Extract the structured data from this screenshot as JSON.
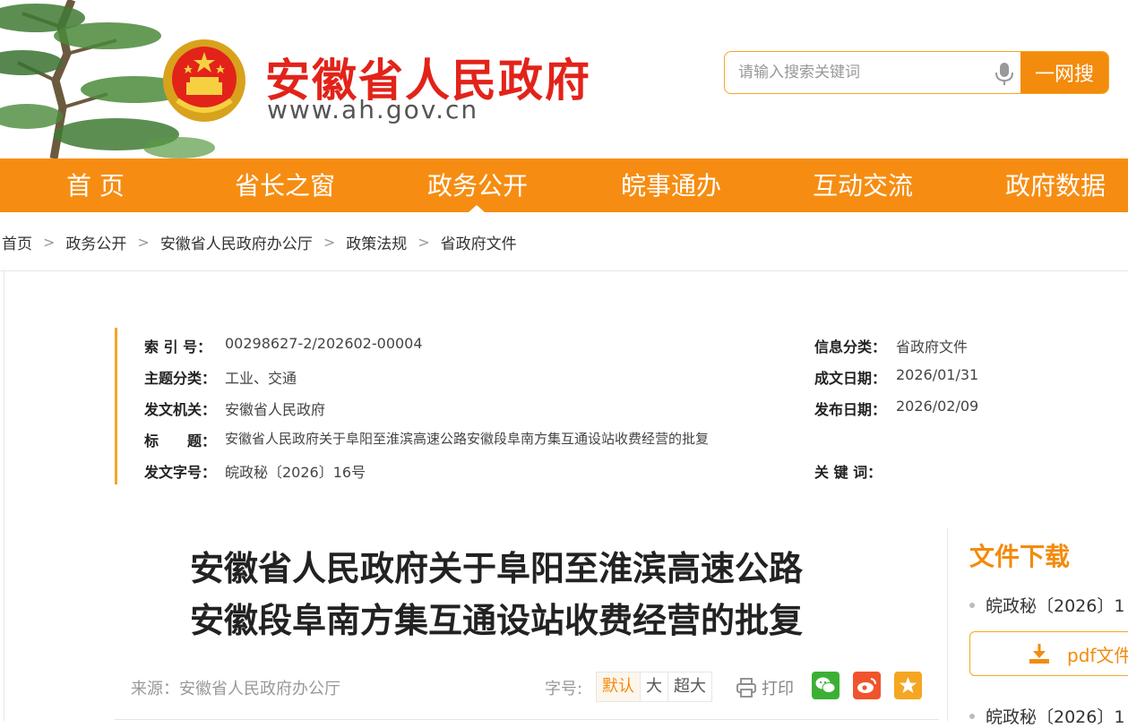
{
  "header": {
    "site_title": "安徽省人民政府",
    "site_url": "www.ah.gov.cn",
    "search_placeholder": "请输入搜索关键词",
    "search_button": "一网搜"
  },
  "nav": {
    "items": [
      {
        "label": "首 页"
      },
      {
        "label": "省长之窗"
      },
      {
        "label": "政务公开",
        "active": true
      },
      {
        "label": "皖事通办"
      },
      {
        "label": "互动交流"
      },
      {
        "label": "政府数据"
      }
    ],
    "accent_color": "#f68d12"
  },
  "breadcrumb": [
    "首页",
    "政务公开",
    "安徽省人民政府办公厅",
    "政策法规",
    "省政府文件"
  ],
  "meta": {
    "index_label": "索 引 号：",
    "index_value": "00298627-2/202602-00004",
    "category_label": "信息分类：",
    "category_value": "省政府文件",
    "topic_label": "主题分类：",
    "topic_value": "工业、交通",
    "written_label": "成文日期：",
    "written_value": "2026/01/31",
    "issuer_label": "发文机关：",
    "issuer_value": "安徽省人民政府",
    "published_label": "发布日期：",
    "published_value": "2026/02/09",
    "title_label": "标　　题：",
    "title_value": "安徽省人民政府关于阜阳至淮滨高速公路安徽段阜南方集互通设站收费经营的批复",
    "doc_no_label": "发文字号：",
    "doc_no_value": "皖政秘〔2026〕16号",
    "keywords_label": "关 键 词：",
    "keywords_value": ""
  },
  "article": {
    "title_line1": "安徽省人民政府关于阜阳至淮滨高速公路",
    "title_line2": "安徽段阜南方集互通设站收费经营的批复",
    "source": "来源：安徽省人民政府办公厅",
    "font_size_label": "字号:",
    "font_sizes": [
      "默认",
      "大",
      "超大"
    ],
    "print_label": "打印"
  },
  "sidebar": {
    "title": "文件下载",
    "item1": "皖政秘〔2026〕1",
    "pdf_label": "pdf文件",
    "item2": "皖政秘〔2026〕1"
  }
}
